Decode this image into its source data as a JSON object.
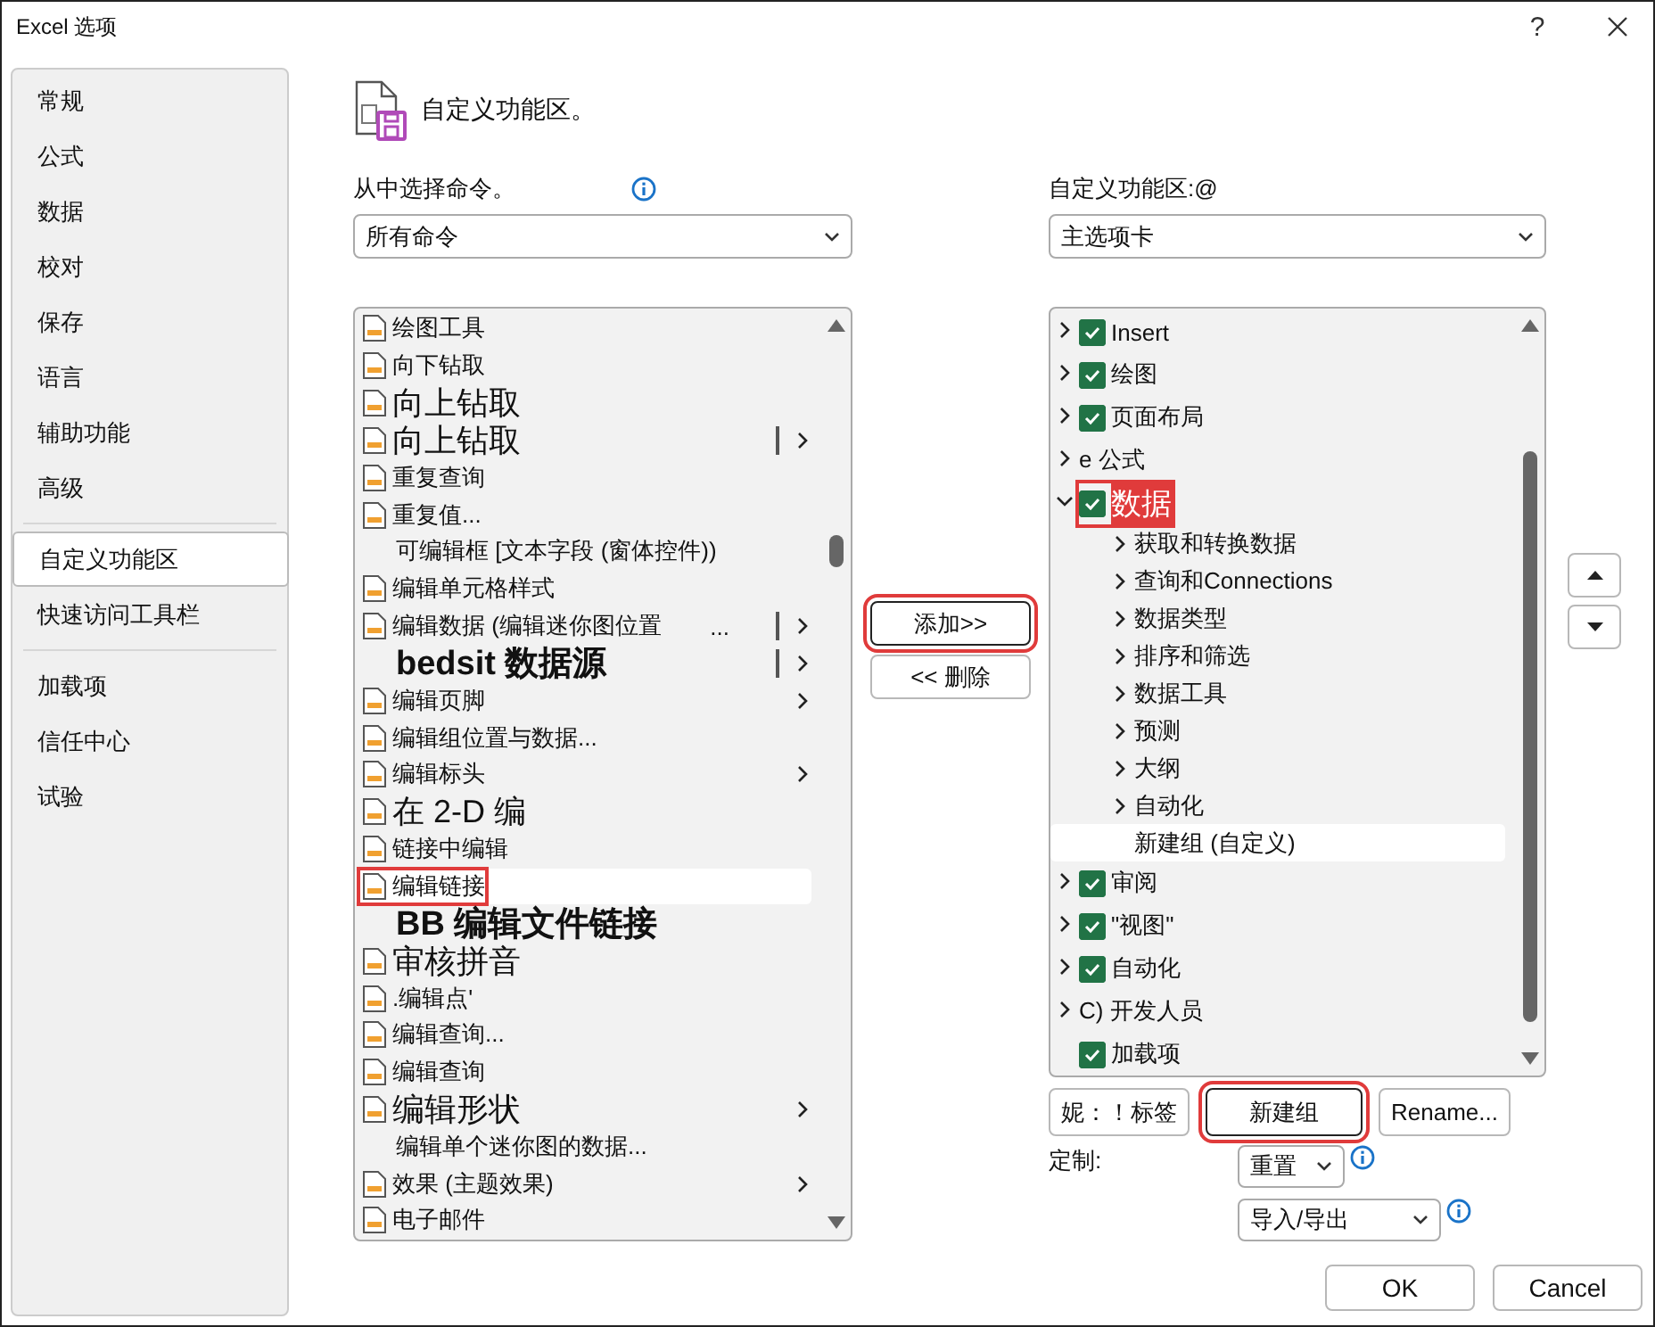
{
  "window": {
    "title": "Excel 选项",
    "help": "?"
  },
  "sidebar": {
    "groups": [
      [
        {
          "label": "常规",
          "selected": false
        },
        {
          "label": "公式",
          "selected": false
        },
        {
          "label": "数据",
          "selected": false
        },
        {
          "label": "校对",
          "selected": false
        },
        {
          "label": "保存",
          "selected": false
        },
        {
          "label": "语言",
          "selected": false
        },
        {
          "label": "辅助功能",
          "selected": false
        },
        {
          "label": "高级",
          "selected": false
        }
      ],
      [
        {
          "label": "自定义功能区",
          "selected": true
        },
        {
          "label": "快速访问工具栏",
          "selected": false
        }
      ],
      [
        {
          "label": "加载项",
          "selected": false
        },
        {
          "label": "信任中心",
          "selected": false
        },
        {
          "label": "试验",
          "selected": false
        }
      ]
    ]
  },
  "header": {
    "title": "自定义功能区。"
  },
  "commands": {
    "label": "从中选择命令。",
    "dropdown": "所有命令",
    "items": [
      {
        "label": "绘图工具",
        "kind": "normal",
        "icon": true,
        "submenu": false,
        "split": false,
        "selected": false,
        "highlighted": false
      },
      {
        "label": "向下钻取",
        "kind": "normal",
        "icon": true,
        "submenu": false,
        "split": false,
        "selected": false,
        "highlighted": false
      },
      {
        "label": "向上钻取",
        "kind": "large",
        "icon": true,
        "submenu": false,
        "split": false,
        "selected": false,
        "highlighted": false
      },
      {
        "label": "向上钻取",
        "kind": "large",
        "icon": true,
        "submenu": true,
        "split": true,
        "selected": false,
        "highlighted": false
      },
      {
        "label": "重复查询",
        "kind": "normal",
        "icon": true,
        "submenu": false,
        "split": false,
        "selected": false,
        "highlighted": false
      },
      {
        "label": "重复值...",
        "kind": "normal",
        "icon": true,
        "submenu": false,
        "split": false,
        "selected": false,
        "highlighted": false
      },
      {
        "label": "可编辑框 [文本字段 (窗体控件))",
        "kind": "normal",
        "icon": false,
        "submenu": false,
        "split": false,
        "selected": false,
        "highlighted": false
      },
      {
        "label": "编辑单元格样式",
        "kind": "normal",
        "icon": true,
        "submenu": false,
        "split": false,
        "selected": false,
        "highlighted": false
      },
      {
        "label": "编辑数据 (编辑迷你图位置",
        "suffix": "...",
        "kind": "normal",
        "icon": true,
        "submenu": true,
        "split": true,
        "selected": false,
        "highlighted": false
      },
      {
        "label": "bedsit 数据源",
        "kind": "bold",
        "icon": false,
        "submenu": true,
        "split": true,
        "selected": false,
        "highlighted": false
      },
      {
        "label": "编辑页脚",
        "kind": "normal",
        "icon": true,
        "submenu": true,
        "split": false,
        "selected": false,
        "highlighted": false
      },
      {
        "label": "编辑组位置与数据...",
        "kind": "normal",
        "icon": true,
        "submenu": false,
        "split": false,
        "selected": false,
        "highlighted": false
      },
      {
        "label": "编辑标头",
        "kind": "normal",
        "icon": true,
        "submenu": true,
        "split": false,
        "selected": false,
        "highlighted": false
      },
      {
        "label": "在 2-D 编",
        "kind": "large",
        "icon": true,
        "submenu": false,
        "split": false,
        "selected": false,
        "highlighted": false
      },
      {
        "label": "链接中编辑",
        "kind": "normal",
        "icon": true,
        "submenu": false,
        "split": false,
        "selected": false,
        "highlighted": false
      },
      {
        "label": "编辑链接",
        "kind": "normal",
        "icon": true,
        "submenu": false,
        "split": false,
        "selected": true,
        "highlighted": true
      },
      {
        "label": "BB 编辑文件链接",
        "kind": "bold",
        "icon": false,
        "submenu": false,
        "split": false,
        "selected": false,
        "highlighted": false
      },
      {
        "label": "审核拼音",
        "kind": "large",
        "icon": true,
        "submenu": false,
        "split": false,
        "selected": false,
        "highlighted": false
      },
      {
        "label": ".编辑点'",
        "kind": "normal",
        "icon": true,
        "submenu": false,
        "split": false,
        "selected": false,
        "highlighted": false
      },
      {
        "label": "编辑查询...",
        "kind": "normal",
        "icon": true,
        "submenu": false,
        "split": false,
        "selected": false,
        "highlighted": false
      },
      {
        "label": "编辑查询",
        "kind": "normal",
        "icon": true,
        "submenu": false,
        "split": false,
        "selected": false,
        "highlighted": false
      },
      {
        "label": "编辑形状",
        "kind": "large",
        "icon": true,
        "submenu": true,
        "split": false,
        "selected": false,
        "highlighted": false
      },
      {
        "label": "编辑单个迷你图的数据...",
        "kind": "normal",
        "icon": false,
        "submenu": false,
        "split": false,
        "selected": false,
        "highlighted": false
      },
      {
        "label": "效果 (主题效果)",
        "kind": "normal",
        "icon": true,
        "submenu": true,
        "split": false,
        "selected": false,
        "highlighted": false
      },
      {
        "label": "电子邮件",
        "kind": "normal",
        "icon": true,
        "submenu": false,
        "split": false,
        "selected": false,
        "highlighted": false
      }
    ]
  },
  "transfer": {
    "buttons": [
      {
        "label": "添加>>",
        "highlighted": true
      },
      {
        "label": "<< 删除",
        "highlighted": false
      }
    ]
  },
  "ribbon": {
    "label": "自定义功能区:@",
    "dropdown": "主选项卡",
    "tabs": [
      {
        "label": "Insert",
        "kind": "check",
        "checked": true,
        "expanded": false,
        "selected": false,
        "highlighted": false
      },
      {
        "label": "绘图",
        "kind": "check",
        "checked": true,
        "expanded": false,
        "selected": false,
        "highlighted": false
      },
      {
        "label": "页面布局",
        "kind": "check",
        "checked": true,
        "expanded": false,
        "selected": false,
        "highlighted": false
      },
      {
        "label": "e 公式",
        "kind": "plain",
        "expanded": false,
        "selected": false,
        "highlighted": false
      },
      {
        "label": "数据",
        "kind": "check",
        "checked": true,
        "expanded": true,
        "selected": true,
        "highlighted": true,
        "children": [
          {
            "label": "获取和转换数据",
            "expandable": true,
            "selected": false
          },
          {
            "label": "查询和Connections",
            "expandable": true,
            "selected": false
          },
          {
            "label": "数据类型",
            "expandable": true,
            "selected": false
          },
          {
            "label": "排序和筛选",
            "expandable": true,
            "selected": false
          },
          {
            "label": "数据工具",
            "expandable": true,
            "selected": false
          },
          {
            "label": "预测",
            "expandable": true,
            "selected": false
          },
          {
            "label": "大纲",
            "expandable": true,
            "selected": false
          },
          {
            "label": "自动化",
            "expandable": true,
            "selected": false
          },
          {
            "label": "新建组 (自定义)",
            "expandable": false,
            "selected": true
          }
        ]
      },
      {
        "label": "审阅",
        "kind": "check",
        "checked": true,
        "expanded": false,
        "selected": false,
        "highlighted": false
      },
      {
        "label": "\"视图\"",
        "kind": "check",
        "checked": true,
        "expanded": false,
        "selected": false,
        "highlighted": false
      },
      {
        "label": "自动化",
        "kind": "check",
        "checked": true,
        "expanded": false,
        "selected": false,
        "highlighted": false
      },
      {
        "label": "C) 开发人员",
        "kind": "plain",
        "expanded": false,
        "selected": false,
        "highlighted": false
      },
      {
        "label": "加载项",
        "kind": "check",
        "checked": true,
        "selected": false,
        "highlighted": false
      }
    ],
    "buttons": [
      {
        "label": "妮：！标签",
        "highlighted": false
      },
      {
        "label": "新建组",
        "highlighted": true
      },
      {
        "label": "Rename...",
        "highlighted": false
      }
    ],
    "customize_label": "定制:",
    "reset": "重置",
    "import_export": "导入/导出"
  },
  "footer": {
    "buttons": [
      "OK",
      "Cancel"
    ]
  }
}
